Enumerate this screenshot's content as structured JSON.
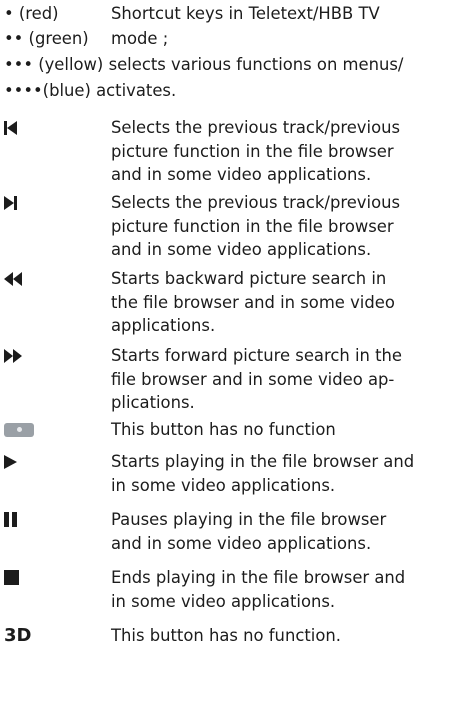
{
  "color_keys": [
    {
      "key": "• (red)",
      "text": "Shortcut keys in Teletext/HBB TV"
    },
    {
      "key": "•• (green)",
      "text": "mode ;"
    },
    {
      "key": "••• (yellow)",
      "text": "selects various functions on menus/"
    },
    {
      "key": "••••(blue)",
      "text": "activates."
    }
  ],
  "entries": [
    {
      "icon": "previous-track-icon",
      "lines": [
        "Selects the previous track/previous",
        "picture function in the file browser",
        "and in some video applications."
      ]
    },
    {
      "icon": "next-track-icon",
      "lines": [
        "Selects the previous track/previous",
        "picture function in the file browser",
        "and in some video applications."
      ]
    },
    {
      "icon": "rewind-icon",
      "lines": [
        "Starts backward picture search in",
        "the file browser and in some video",
        "applications."
      ]
    },
    {
      "icon": "fast-forward-icon",
      "lines": [
        "Starts forward picture search in the",
        "file browser and in some video ap-",
        "plications."
      ]
    },
    {
      "icon": "record-button-icon",
      "lines": [
        "This button has no function"
      ]
    },
    {
      "icon": "play-icon",
      "lines": [
        "Starts playing in the file browser and",
        "in some video applications."
      ]
    },
    {
      "icon": "pause-icon",
      "lines": [
        "Pauses playing in the file browser",
        "and in some video applications."
      ]
    },
    {
      "icon": "stop-icon",
      "lines": [
        "Ends playing in the file browser and",
        "in some video applications."
      ]
    },
    {
      "icon": "3d-label",
      "label": "3D",
      "lines": [
        "This button has no function."
      ]
    }
  ]
}
